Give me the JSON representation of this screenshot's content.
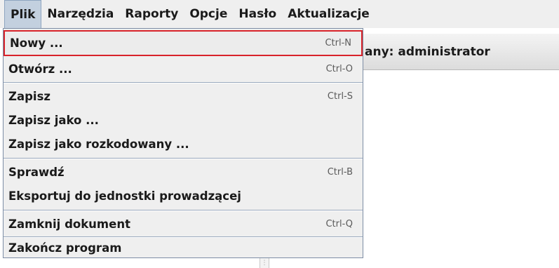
{
  "menubar": {
    "items": [
      {
        "label": "Plik"
      },
      {
        "label": "Narzędzia"
      },
      {
        "label": "Raporty"
      },
      {
        "label": "Opcje"
      },
      {
        "label": "Hasło"
      },
      {
        "label": "Aktualizacje"
      }
    ]
  },
  "status": {
    "text": "any: administrator"
  },
  "file_menu": {
    "items": [
      {
        "label": "Nowy ...",
        "shortcut": "Ctrl-N"
      },
      {
        "label": "Otwórz ...",
        "shortcut": "Ctrl-O"
      },
      {
        "label": "Zapisz",
        "shortcut": "Ctrl-S"
      },
      {
        "label": "Zapisz jako ...",
        "shortcut": ""
      },
      {
        "label": "Zapisz jako rozkodowany ...",
        "shortcut": ""
      },
      {
        "label": "Sprawdź",
        "shortcut": "Ctrl-B"
      },
      {
        "label": "Eksportuj do jednostki prowadzącej",
        "shortcut": ""
      },
      {
        "label": "Zamknij dokument",
        "shortcut": "Ctrl-Q"
      },
      {
        "label": "Zakończ program",
        "shortcut": ""
      }
    ]
  },
  "colors": {
    "highlight_border": "#d8232a",
    "menu_background": "#efefef",
    "active_menu": "#c3d0df"
  }
}
